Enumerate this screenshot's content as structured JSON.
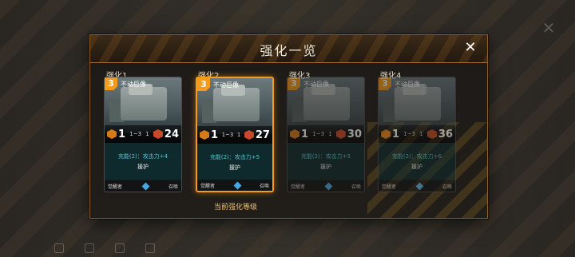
{
  "dialog": {
    "title": "强化一览"
  },
  "cards": [
    {
      "label": "强化1",
      "cost": "3",
      "name": "不动巨像",
      "attack": "1",
      "range": "1~3",
      "mid": "1",
      "hp": "24",
      "text1": "充能(2)：攻击力+4",
      "text2": "援护",
      "footer_left": "觉醒者",
      "footer_right": "召唤",
      "state": "normal"
    },
    {
      "label": "强化2",
      "cost": "3",
      "name": "不动巨像",
      "attack": "1",
      "range": "1~3",
      "mid": "1",
      "hp": "27",
      "text1": "充能(2)：攻击力+5",
      "text2": "援护",
      "footer_left": "觉醒者",
      "footer_right": "召唤",
      "state": "selected"
    },
    {
      "label": "强化3",
      "cost": "3",
      "name": "不动巨像",
      "attack": "1",
      "range": "1~3",
      "mid": "1",
      "hp": "30",
      "text1": "充能(2)：攻击力+5",
      "text2": "援护",
      "footer_left": "觉醒者",
      "footer_right": "召唤",
      "state": "dim"
    },
    {
      "label": "强化4",
      "cost": "3",
      "name": "不动巨像",
      "attack": "1",
      "range": "1~3",
      "mid": "1",
      "hp": "36",
      "text1": "充能(2)：攻击力+6",
      "text2": "援护",
      "footer_left": "觉醒者",
      "footer_right": "召唤",
      "state": "dim"
    }
  ],
  "current_level_label": "当前强化等级",
  "colors": {
    "accent": "#f39b1c",
    "text_skill": "#55c7d4",
    "border": "#8d5b25"
  },
  "icons": {
    "close": "close-icon",
    "gem": "gem-icon"
  }
}
